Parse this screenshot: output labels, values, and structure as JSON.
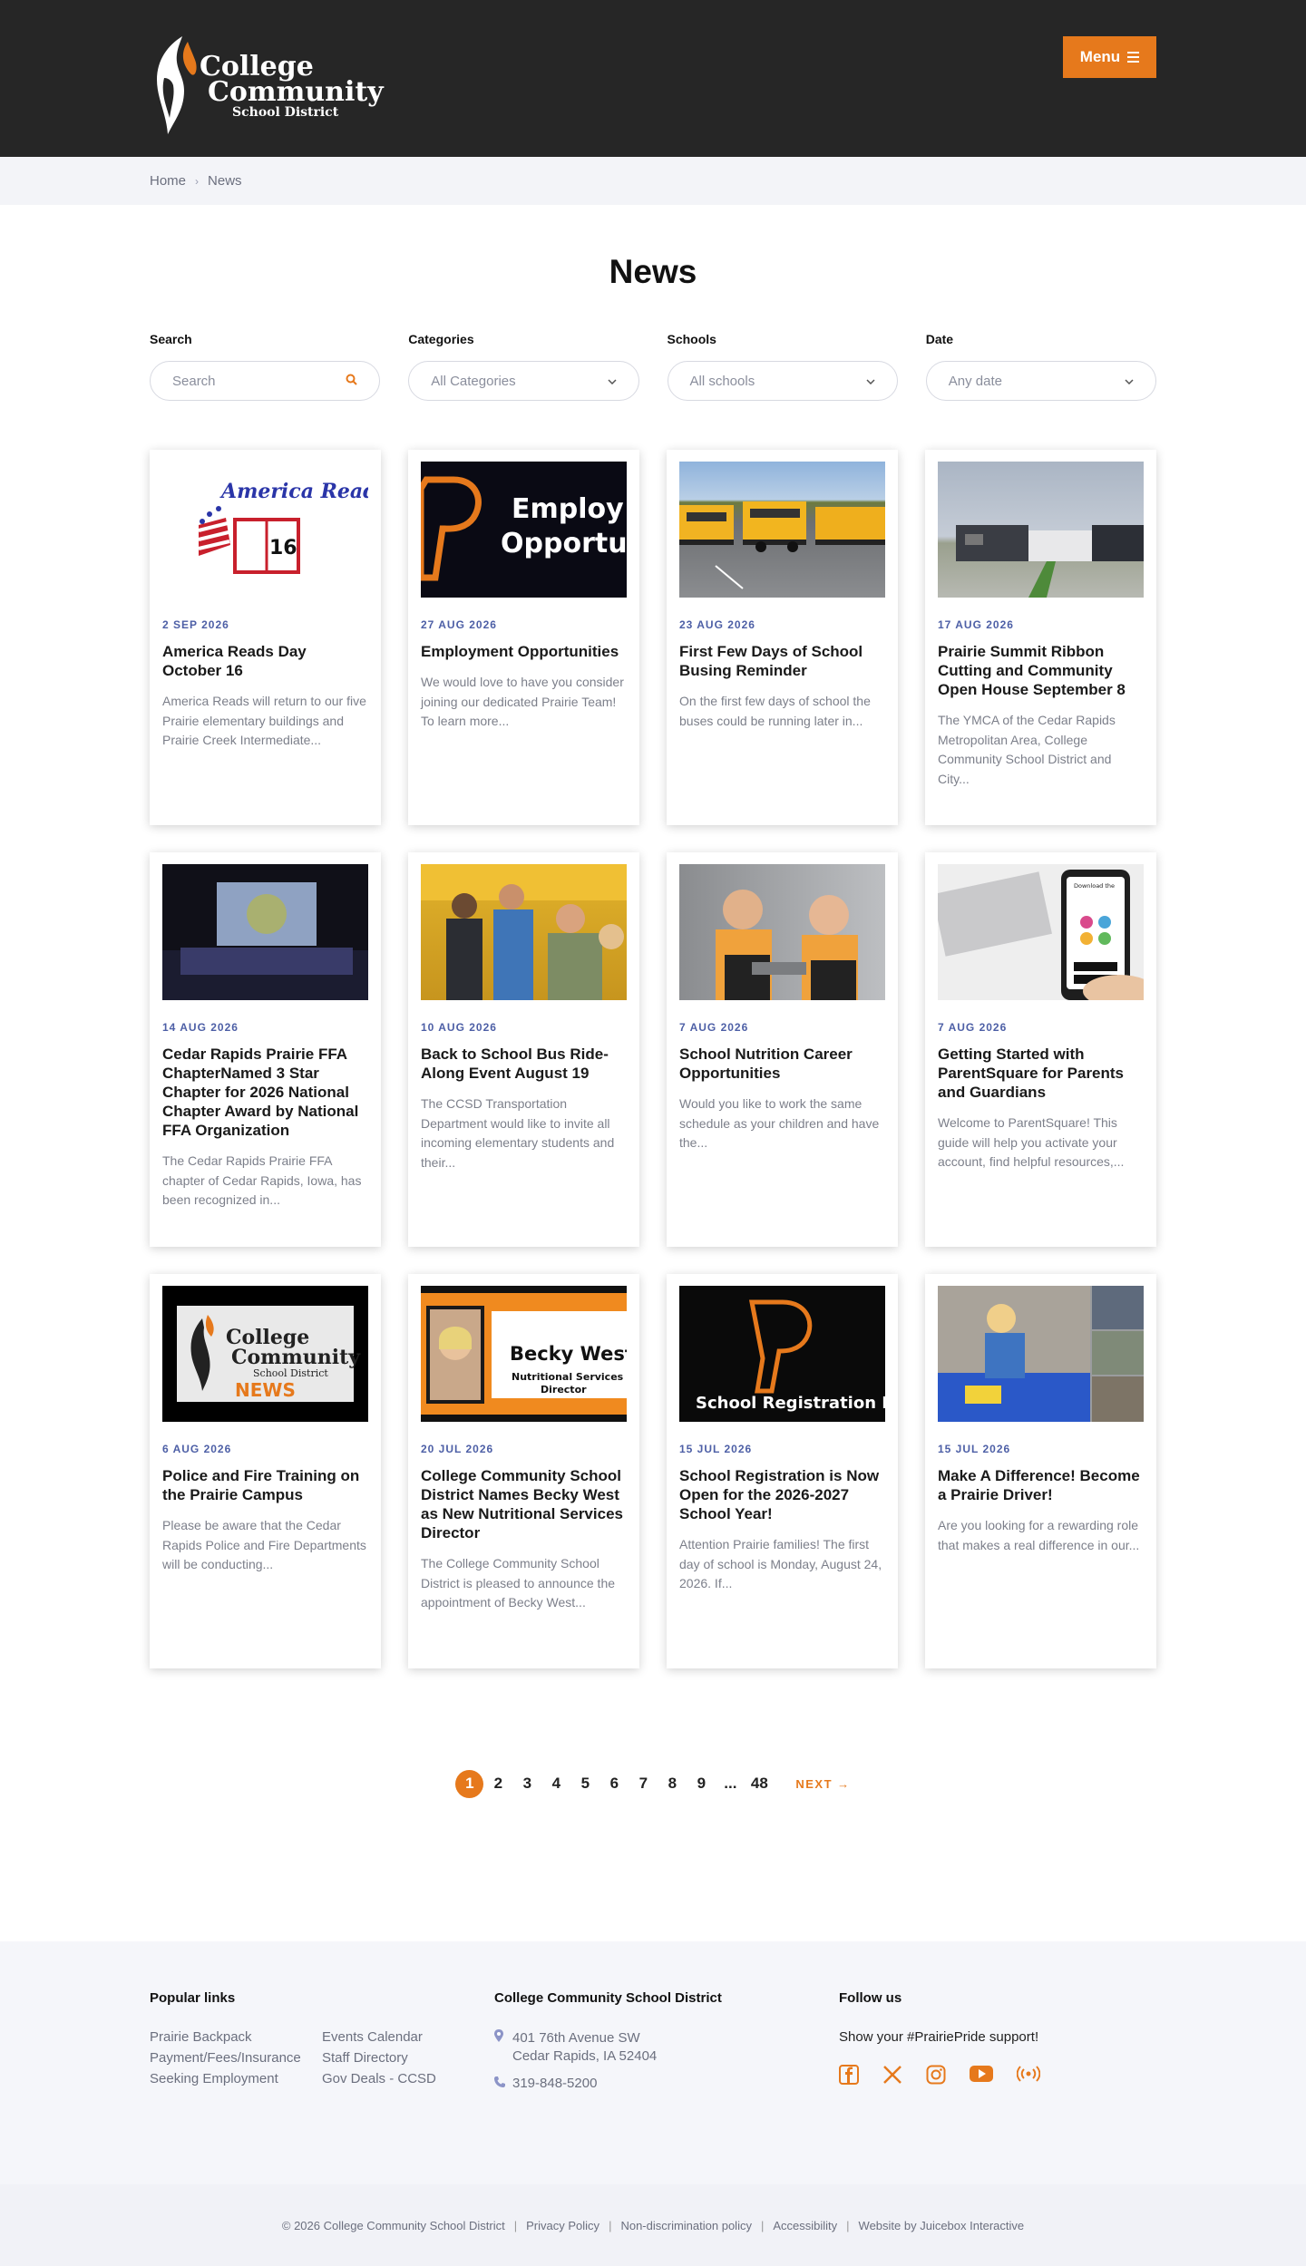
{
  "header": {
    "logo": {
      "line1": "College",
      "line2": "Community",
      "line3": "School District"
    },
    "menu_label": "Menu",
    "colors": {
      "header_bg": "#262626",
      "accent": "#e6791c"
    }
  },
  "breadcrumb": {
    "home": "Home",
    "current": "News"
  },
  "page_title": "News",
  "filters": {
    "search": {
      "label": "Search",
      "placeholder": "Search"
    },
    "categories": {
      "label": "Categories",
      "value": "All Categories"
    },
    "schools": {
      "label": "Schools",
      "value": "All schools"
    },
    "date": {
      "label": "Date",
      "value": "Any date"
    }
  },
  "articles": [
    {
      "date": "2 SEP 2026",
      "title": "America Reads Day October 16",
      "excerpt": "America Reads will return to our five Prairie elementary buildings and Prairie Creek Intermediate...",
      "image_text": "America Reads"
    },
    {
      "date": "27 AUG 2026",
      "title": "Employment Opportunities",
      "excerpt": "We would love to have you consider joining our dedicated Prairie Team! To learn more...",
      "image_text": "Employ Opportu"
    },
    {
      "date": "23 AUG 2026",
      "title": "First Few Days of School Busing Reminder",
      "excerpt": "On the first few days of school the buses could be running later in...",
      "image_text": ""
    },
    {
      "date": "17 AUG 2026",
      "title": "Prairie Summit Ribbon Cutting and Community Open House September 8",
      "excerpt": "The YMCA of the Cedar Rapids Metropolitan Area, College Community School District and City...",
      "image_text": ""
    },
    {
      "date": "14 AUG 2026",
      "title": "Cedar Rapids Prairie FFA ChapterNamed 3 Star Chapter for 2026 National Chapter Award by National FFA Organization",
      "excerpt": "The Cedar Rapids Prairie FFA chapter of Cedar Rapids, Iowa, has been recognized in...",
      "image_text": ""
    },
    {
      "date": "10 AUG 2026",
      "title": "Back to School Bus Ride-Along Event August 19",
      "excerpt": "The CCSD Transportation Department would like to invite all incoming elementary students and their...",
      "image_text": ""
    },
    {
      "date": "7 AUG 2026",
      "title": "School Nutrition Career Opportunities",
      "excerpt": "Would you like to work the same schedule as your children and have the...",
      "image_text": ""
    },
    {
      "date": "7 AUG 2026",
      "title": "Getting Started with ParentSquare for Parents and Guardians",
      "excerpt": "Welcome to ParentSquare! This guide will help you activate your account, find helpful resources,...",
      "image_text": "Download the ParentSquare app today!"
    },
    {
      "date": "6 AUG 2026",
      "title": "Police and Fire Training on the Prairie Campus",
      "excerpt": "Please be aware that the Cedar Rapids Police and Fire Departments will be conducting...",
      "image_text": "NEWS"
    },
    {
      "date": "20 JUL 2026",
      "title": "College Community School District Names Becky West as New Nutritional Services Director",
      "excerpt": "The College Community School District is pleased to announce the appointment of Becky West...",
      "image_text": "Becky West"
    },
    {
      "date": "15 JUL 2026",
      "title": "School Registration is Now Open for the 2026-2027 School Year!",
      "excerpt": "Attention Prairie families! The first day of school is Monday, August 24, 2026. If...",
      "image_text": "School Registration Is Now Open!"
    },
    {
      "date": "15 JUL 2026",
      "title": "Make A Difference! Become a Prairie Driver!",
      "excerpt": "Are you looking for a rewarding role that makes a real difference in our...",
      "image_text": ""
    }
  ],
  "pagination": {
    "pages": [
      "1",
      "2",
      "3",
      "4",
      "5",
      "6",
      "7",
      "8",
      "9",
      "...",
      "48"
    ],
    "current": "1",
    "next_label": "NEXT →"
  },
  "footer": {
    "popular_title": "Popular links",
    "links": [
      "Prairie Backpack",
      "Events Calendar",
      "Payment/Fees/Insurance",
      "Staff Directory",
      "Seeking Employment",
      "Gov Deals - CCSD"
    ],
    "district_title": "College Community School District",
    "address_line1": "401 76th Avenue SW",
    "address_line2": "Cedar Rapids, IA 52404",
    "phone": "319-848-5200",
    "follow_title": "Follow us",
    "follow_text": "Show your #PrairiePride support!",
    "socials": [
      "facebook-icon",
      "x-icon",
      "instagram-icon",
      "youtube-icon",
      "podcast-icon"
    ]
  },
  "bottom_bar": {
    "copyright": "© 2026 College Community School District",
    "privacy": "Privacy Policy",
    "nondiscrimination": "Non-discrimination policy",
    "accessibility": "Accessibility",
    "credit": "Website by Juicebox Interactive"
  }
}
